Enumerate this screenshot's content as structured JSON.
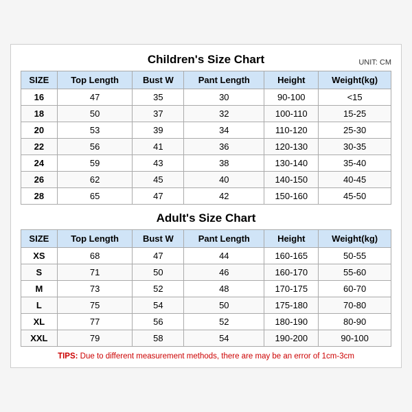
{
  "children_chart": {
    "title": "Children's Size Chart",
    "unit": "UNIT: CM",
    "headers": [
      "SIZE",
      "Top Length",
      "Bust W",
      "Pant Length",
      "Height",
      "Weight(kg)"
    ],
    "rows": [
      [
        "16",
        "47",
        "35",
        "30",
        "90-100",
        "<15"
      ],
      [
        "18",
        "50",
        "37",
        "32",
        "100-110",
        "15-25"
      ],
      [
        "20",
        "53",
        "39",
        "34",
        "110-120",
        "25-30"
      ],
      [
        "22",
        "56",
        "41",
        "36",
        "120-130",
        "30-35"
      ],
      [
        "24",
        "59",
        "43",
        "38",
        "130-140",
        "35-40"
      ],
      [
        "26",
        "62",
        "45",
        "40",
        "140-150",
        "40-45"
      ],
      [
        "28",
        "65",
        "47",
        "42",
        "150-160",
        "45-50"
      ]
    ]
  },
  "adult_chart": {
    "title": "Adult's Size Chart",
    "headers": [
      "SIZE",
      "Top Length",
      "Bust W",
      "Pant Length",
      "Height",
      "Weight(kg)"
    ],
    "rows": [
      [
        "XS",
        "68",
        "47",
        "44",
        "160-165",
        "50-55"
      ],
      [
        "S",
        "71",
        "50",
        "46",
        "160-170",
        "55-60"
      ],
      [
        "M",
        "73",
        "52",
        "48",
        "170-175",
        "60-70"
      ],
      [
        "L",
        "75",
        "54",
        "50",
        "175-180",
        "70-80"
      ],
      [
        "XL",
        "77",
        "56",
        "52",
        "180-190",
        "80-90"
      ],
      [
        "XXL",
        "79",
        "58",
        "54",
        "190-200",
        "90-100"
      ]
    ]
  },
  "tips": {
    "label": "TIPS:",
    "text": " Due to different measurement methods, there are may be an error of 1cm-3cm"
  }
}
